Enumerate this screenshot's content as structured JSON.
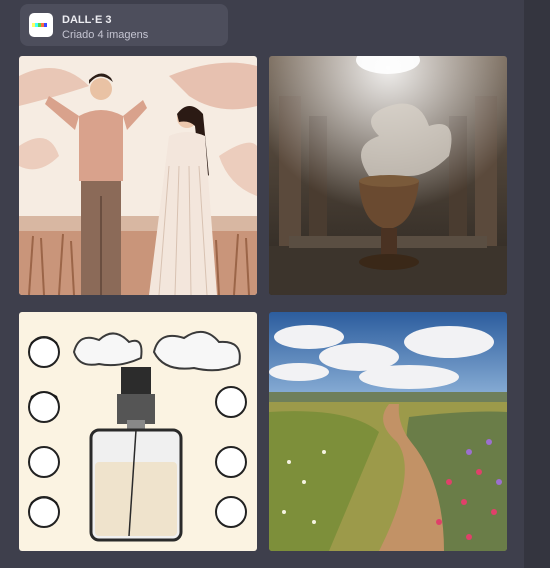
{
  "header": {
    "icon": "dalle-logo-icon",
    "title": "DALL·E 3",
    "subtitle": "Criado 4 imagens",
    "logo_colors": [
      "#ffff66",
      "#42ffff",
      "#51da4c",
      "#ff6e3c",
      "#3c46ff"
    ]
  },
  "images": [
    {
      "subject": "couple-praying-field-image"
    },
    {
      "subject": "smoking-urn-temple-image"
    },
    {
      "subject": "perfume-bottle-faces-image"
    },
    {
      "subject": "path-flower-field-image"
    }
  ]
}
